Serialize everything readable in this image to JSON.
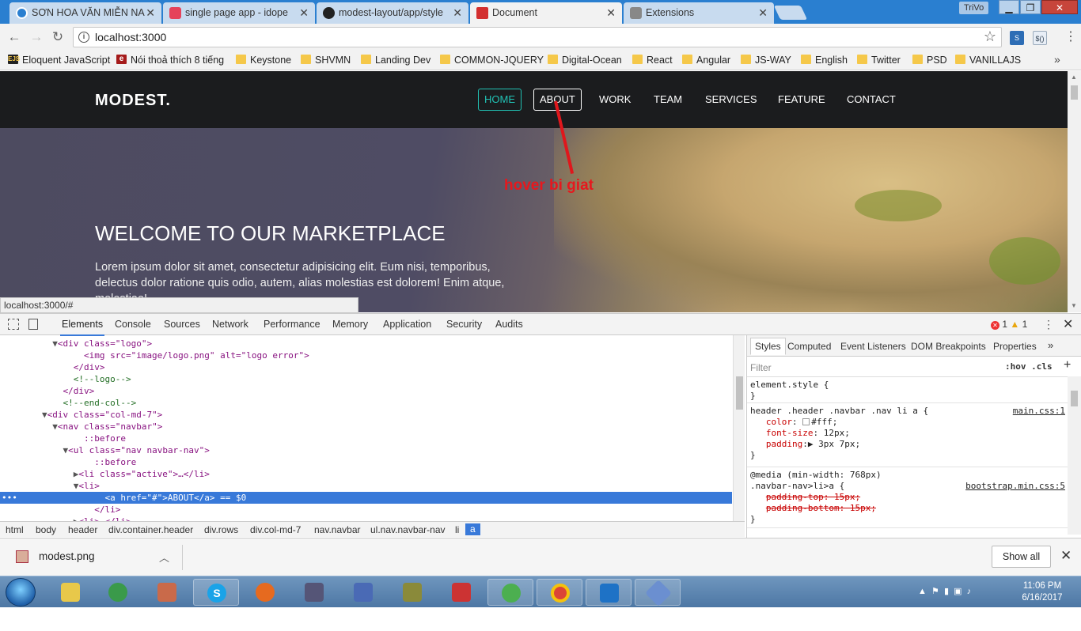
{
  "browser": {
    "tabs": [
      {
        "title": "SƠN HOA VĂN MIỄN NA"
      },
      {
        "title": "single page app - idope"
      },
      {
        "title": "modest-layout/app/style"
      },
      {
        "title": "Document"
      },
      {
        "title": "Extensions"
      }
    ],
    "profile_name": "TriVo",
    "url": "localhost:3000",
    "bookmarks": [
      "Eloquent JavaScript",
      "Nói thoả thích 8 tiếng",
      "Keystone",
      "SHVMN",
      "Landing Dev",
      "COMMON-JQUERY",
      "Digital-Ocean",
      "React",
      "Angular",
      "JS-WAY",
      "English",
      "Twitter",
      "PSD",
      "VANILLAJS"
    ],
    "status_url": "localhost:3000/#"
  },
  "page": {
    "logo": "MODEST.",
    "nav": [
      "HOME",
      "ABOUT",
      "WORK",
      "TEAM",
      "SERVICES",
      "FEATURE",
      "CONTACT"
    ],
    "annotation": "hover bi giat",
    "hero_title": "WELCOME TO OUR MARKETPLACE",
    "hero_text": "Lorem ipsum dolor sit amet, consectetur adipisicing elit. Eum nisi, temporibus, delectus dolor ratione quis odio, autem, alias molestias est dolorem! Enim atque, molestiae!"
  },
  "devtools": {
    "tabs": [
      "Elements",
      "Console",
      "Sources",
      "Network",
      "Performance",
      "Memory",
      "Application",
      "Security",
      "Audits"
    ],
    "error_count": "1",
    "warning_count": "1",
    "dom_lines": [
      {
        "indent": 6,
        "arrow": "▼",
        "html": "<div class=\"logo\">"
      },
      {
        "indent": 8,
        "arrow": "",
        "html": "<img src=\"image/logo.png\" alt=\"logo error\">"
      },
      {
        "indent": 7,
        "arrow": "",
        "html": "</div>"
      },
      {
        "indent": 7,
        "arrow": "",
        "html": "<!--logo-->"
      },
      {
        "indent": 6,
        "arrow": "",
        "html": "</div>"
      },
      {
        "indent": 6,
        "arrow": "",
        "html": "<!--end-col-->"
      },
      {
        "indent": 5,
        "arrow": "▼",
        "html": "<div class=\"col-md-7\">"
      },
      {
        "indent": 6,
        "arrow": "▼",
        "html": "<nav class=\"navbar\">"
      },
      {
        "indent": 8,
        "arrow": "",
        "html": "::before"
      },
      {
        "indent": 7,
        "arrow": "▼",
        "html": "<ul class=\"nav navbar-nav\">"
      },
      {
        "indent": 9,
        "arrow": "",
        "html": "::before"
      },
      {
        "indent": 8,
        "arrow": "▶",
        "html": "<li class=\"active\">…</li>"
      },
      {
        "indent": 8,
        "arrow": "▼",
        "html": "<li>"
      },
      {
        "indent": 10,
        "arrow": "",
        "html": "<a href=\"#\">ABOUT</a> == $0"
      },
      {
        "indent": 9,
        "arrow": "",
        "html": "</li>"
      },
      {
        "indent": 8,
        "arrow": "▶",
        "html": "<li>…</li>"
      }
    ],
    "breadcrumbs": [
      "html",
      "body",
      "header",
      "div.container.header",
      "div.rows",
      "div.col-md-7",
      "nav.navbar",
      "ul.nav.navbar-nav",
      "li",
      "a"
    ],
    "styles_tabs": [
      "Styles",
      "Computed",
      "Event Listeners",
      "DOM Breakpoints",
      "Properties"
    ],
    "filter_placeholder": "Filter",
    "filter_tools": ":hov  .cls",
    "rules": {
      "element_style": "element.style {",
      "rule1_selector": "header .header .navbar .nav li a {",
      "rule1_src": "main.css:1",
      "rule1_color": "#fff;",
      "rule1_fontsize": "12px;",
      "rule1_padding": "3px 7px;",
      "rule2_media": "@media (min-width: 768px)",
      "rule2_selector": ".navbar-nav>li>a {",
      "rule2_src": "bootstrap.min.css:5",
      "rule2_pt": "padding-top: 15px;",
      "rule2_pb": "padding-bottom: 15px;"
    }
  },
  "downloads": {
    "file": "modest.png",
    "show_all": "Show all"
  },
  "taskbar": {
    "time": "11:06 PM",
    "date": "6/16/2017"
  }
}
